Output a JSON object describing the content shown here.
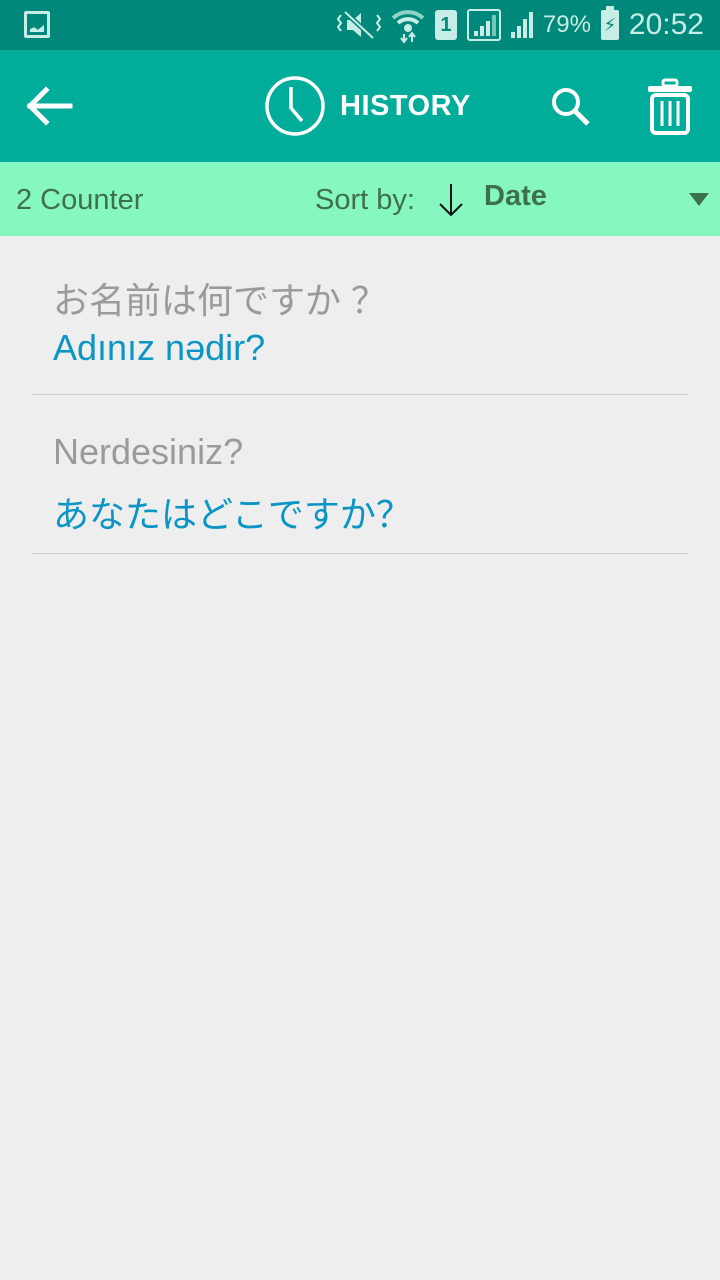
{
  "status_bar": {
    "battery_percent": "79%",
    "time": "20:52",
    "sim_slot": "1",
    "icons": [
      "gallery-notification-icon",
      "vibrate-mute-icon",
      "wifi-data-icon",
      "sim-icon",
      "signal-icon",
      "signal-icon",
      "battery-charging-icon"
    ]
  },
  "app_bar": {
    "title": "HISTORY",
    "back_icon": "arrow-left-icon",
    "title_icon": "clock-icon",
    "search_icon": "search-icon",
    "delete_icon": "trash-icon",
    "background": "#00ad9a"
  },
  "sub_bar": {
    "counter": "2 Counter",
    "sort_label": "Sort by:",
    "sort_direction_icon": "arrow-down-icon",
    "sort_value": "Date",
    "background": "#86f7c0"
  },
  "history": [
    {
      "source": "お名前は何ですか ？",
      "translation": "Adınız nədir?"
    },
    {
      "source": "Nerdesiniz?",
      "translation": "あなたはどこですか？"
    }
  ],
  "colors": {
    "source_text": "#9a9a9a",
    "translation_text": "#0b95c4"
  }
}
